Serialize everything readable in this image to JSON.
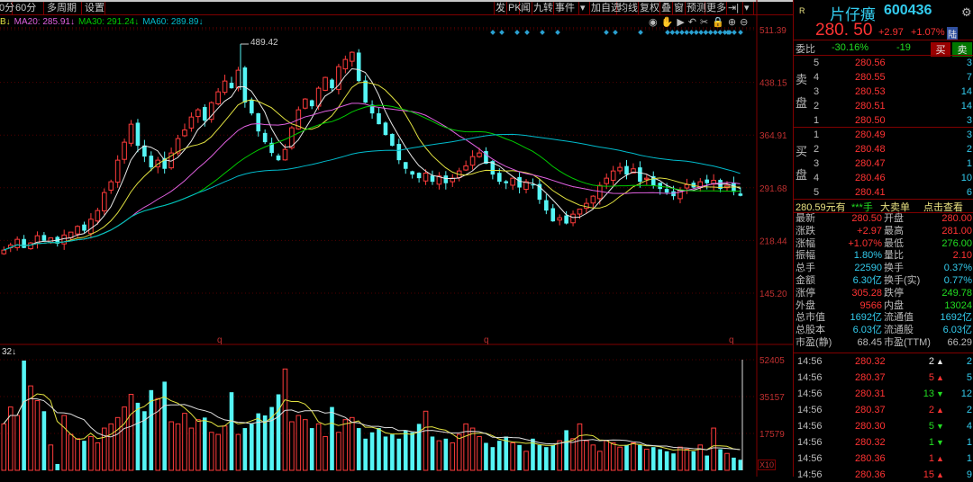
{
  "toolbar": {
    "left": [
      "0分",
      "60分",
      "多周期",
      "设置"
    ],
    "right": [
      "发",
      "PK",
      "闻",
      "九转",
      "事件",
      "▾",
      "加自选",
      "均线",
      "复权",
      "叠",
      "窗",
      "预测",
      "更多",
      "⇥|",
      "▾"
    ],
    "icons": [
      "eye-icon",
      "hand-icon",
      "play-icon",
      "undo-icon",
      "scissors-icon",
      "lock-icon",
      "zoom-in-icon",
      "zoom-out-icon"
    ],
    "icon_glyphs": [
      "◉",
      "✋",
      "▶",
      "↶",
      "✂",
      "🔒",
      "⊕",
      "⊖"
    ]
  },
  "legend": [
    {
      "text": "B↓",
      "color": "#e0e040"
    },
    {
      "text": "MA20: 285.91↓",
      "color": "#e060e0"
    },
    {
      "text": "MA30: 291.24↓",
      "color": "#00cc00"
    },
    {
      "text": "MA60: 289.89↓",
      "color": "#00bbcc"
    }
  ],
  "price_axis": [
    "511.39",
    "438.15",
    "364.91",
    "291.68",
    "218.44",
    "145.20"
  ],
  "peak_label": "489.42",
  "q_marks": [
    "q",
    "q",
    "q"
  ],
  "volume_legend": "32↓",
  "volume_axis": [
    "52405",
    "35157",
    "17579"
  ],
  "volume_unit": "X10",
  "chart_data": {
    "type": "candlestick",
    "ylim": [
      145.2,
      511.39
    ],
    "volume_ylim": [
      0,
      52405
    ],
    "closes": [
      205,
      212,
      220,
      208,
      215,
      225,
      218,
      222,
      214,
      226,
      230,
      238,
      232,
      248,
      260,
      285,
      300,
      330,
      355,
      380,
      350,
      335,
      320,
      330,
      318,
      340,
      360,
      372,
      390,
      400,
      385,
      410,
      425,
      440,
      430,
      455,
      410,
      395,
      370,
      355,
      340,
      330,
      345,
      375,
      400,
      415,
      405,
      430,
      445,
      430,
      460,
      470,
      480,
      440,
      410,
      395,
      380,
      365,
      350,
      330,
      318,
      310,
      305,
      312,
      300,
      308,
      298,
      305,
      315,
      322,
      335,
      340,
      325,
      310,
      300,
      298,
      305,
      292,
      300,
      295,
      275,
      260,
      245,
      250,
      242,
      255,
      262,
      270,
      280,
      295,
      305,
      315,
      320,
      310,
      318,
      300,
      305,
      295,
      290,
      285,
      280,
      288,
      296,
      292,
      300,
      298,
      302,
      290,
      295,
      286,
      280.5
    ],
    "volumes": [
      22000,
      30000,
      26000,
      52000,
      40000,
      33000,
      28000,
      12000,
      3000,
      26000,
      17000,
      15000,
      14000,
      16000,
      13000,
      20000,
      22000,
      25000,
      30000,
      36000,
      32000,
      28000,
      38000,
      34000,
      42000,
      23000,
      22000,
      27000,
      20000,
      24000,
      25000,
      18000,
      17000,
      21000,
      37000,
      17000,
      20000,
      22000,
      27000,
      26000,
      30000,
      36000,
      48000,
      23000,
      26000,
      24000,
      20000,
      22000,
      16000,
      30000,
      18000,
      24000,
      25000,
      20000,
      15000,
      18000,
      20000,
      16000,
      17000,
      15000,
      19000,
      18000,
      22000,
      28000,
      16000,
      14000,
      15000,
      13000,
      17000,
      22000,
      20000,
      16000,
      13000,
      11000,
      14000,
      16000,
      13000,
      12000,
      9000,
      15000,
      12000,
      11000,
      12000,
      14000,
      19000,
      15000,
      22000,
      14000,
      12000,
      9000,
      14000,
      13000,
      11000,
      12000,
      13000,
      12000,
      10000,
      11000,
      10000,
      9000,
      8000,
      11000,
      10000,
      9000,
      12000,
      7000,
      20000,
      10000,
      8000,
      6000,
      5000
    ]
  },
  "quote": {
    "badge": "R",
    "name": "片仔癀",
    "code": "600436",
    "price": "280. 50",
    "change": "+2.97",
    "pct": "+1.07%",
    "tag": "陆",
    "wb_label": "委比",
    "wb_pct": "-30.16%",
    "wb_diff": "-19",
    "buy_btn": "买",
    "sell_btn": "卖",
    "sell_label": [
      "卖",
      "盘"
    ],
    "buy_label": [
      "买",
      "盘"
    ],
    "asks": [
      {
        "n": "5",
        "p": "280.56",
        "v": "3"
      },
      {
        "n": "4",
        "p": "280.55",
        "v": "7"
      },
      {
        "n": "3",
        "p": "280.53",
        "v": "14"
      },
      {
        "n": "2",
        "p": "280.51",
        "v": "14"
      },
      {
        "n": "1",
        "p": "280.50",
        "v": "3"
      }
    ],
    "bids": [
      {
        "n": "1",
        "p": "280.49",
        "v": "3"
      },
      {
        "n": "2",
        "p": "280.48",
        "v": "2"
      },
      {
        "n": "3",
        "p": "280.47",
        "v": "1"
      },
      {
        "n": "4",
        "p": "280.46",
        "v": "10"
      },
      {
        "n": "5",
        "p": "280.41",
        "v": "6"
      }
    ],
    "big_order": {
      "price": "280.59元有",
      "qty": "***手",
      "type": "大卖单",
      "link": "点击查看"
    },
    "stats": [
      [
        "最新",
        "280.50",
        "red",
        "开盘",
        "280.00",
        "red"
      ],
      [
        "涨跌",
        "+2.97",
        "red",
        "最高",
        "281.00",
        "red"
      ],
      [
        "涨幅",
        "+1.07%",
        "red",
        "最低",
        "276.00",
        "grn"
      ],
      [
        "振幅",
        "1.80%",
        "cyn",
        "量比",
        "2.10",
        "red"
      ],
      [
        "总手",
        "22590",
        "cyn",
        "换手",
        "0.37%",
        "cyn"
      ],
      [
        "金额",
        "6.30亿",
        "cyn",
        "换手(实)",
        "0.77%",
        "cyn"
      ],
      [
        "涨停",
        "305.28",
        "red",
        "跌停",
        "249.78",
        "grn"
      ],
      [
        "外盘",
        "9566",
        "red",
        "内盘",
        "13024",
        "grn"
      ],
      [
        "总市值",
        "1692亿",
        "cyn",
        "流通值",
        "1692亿",
        "cyn"
      ],
      [
        "总股本",
        "6.03亿",
        "cyn",
        "流通股",
        "6.03亿",
        "cyn"
      ],
      [
        "市盈(静)",
        "68.45",
        "gry",
        "市盈(TTM)",
        "66.29",
        "gry"
      ]
    ],
    "ticks": [
      [
        "14:56",
        "280.32",
        "2",
        "wht",
        "up",
        "2"
      ],
      [
        "14:56",
        "280.37",
        "5",
        "red",
        "up",
        "5"
      ],
      [
        "14:56",
        "280.31",
        "13",
        "grn",
        "down",
        "12"
      ],
      [
        "14:56",
        "280.37",
        "2",
        "red",
        "up",
        "2"
      ],
      [
        "14:56",
        "280.30",
        "5",
        "grn",
        "down",
        "4"
      ],
      [
        "14:56",
        "280.32",
        "1",
        "grn",
        "down",
        "1"
      ],
      [
        "14:56",
        "280.36",
        "1",
        "red",
        "up",
        "1"
      ],
      [
        "14:56",
        "280.36",
        "15",
        "red",
        "up",
        "9"
      ]
    ]
  }
}
